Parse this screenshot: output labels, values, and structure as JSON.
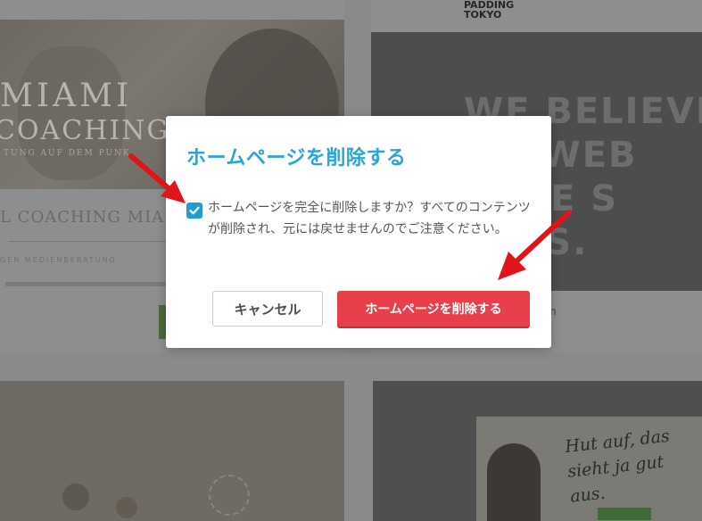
{
  "background": {
    "site_left": {
      "logo_line1": "MIAMI",
      "logo_line2": "COACHING",
      "logo_line3": "TUNG AUF DEM PUNK",
      "subtitle": "L COACHING MIAI",
      "small_text": "GEN MEDIENBERATUNG"
    },
    "site_right": {
      "logo_line1": "PADDING",
      "logo_line2": "TOKYO",
      "headline_lines": [
        "WE BELIEVE",
        "ND WEB",
        "AUSE S",
        "TERS."
      ],
      "url_fragment": "m"
    },
    "site_bottom_right": {
      "script_line1": "Hut auf, das",
      "script_line2": "sieht ja gut aus."
    }
  },
  "dialog": {
    "title": "ホームページを削除する",
    "checkbox_checked": true,
    "checkbox_label": "ホームページを完全に削除しますか？すべてのコンテンツが削除され、元には戻せませんのでご注意ください。",
    "cancel_label": "キャンセル",
    "delete_label": "ホームページを削除する"
  },
  "colors": {
    "title": "#28a6d6",
    "checkbox": "#1f9ed4",
    "delete_button": "#e8404a",
    "arrow": "#e0141b"
  },
  "icons": {
    "checkbox": "checkmark-icon",
    "annotation_1": "red-arrow-icon",
    "annotation_2": "red-arrow-icon"
  }
}
